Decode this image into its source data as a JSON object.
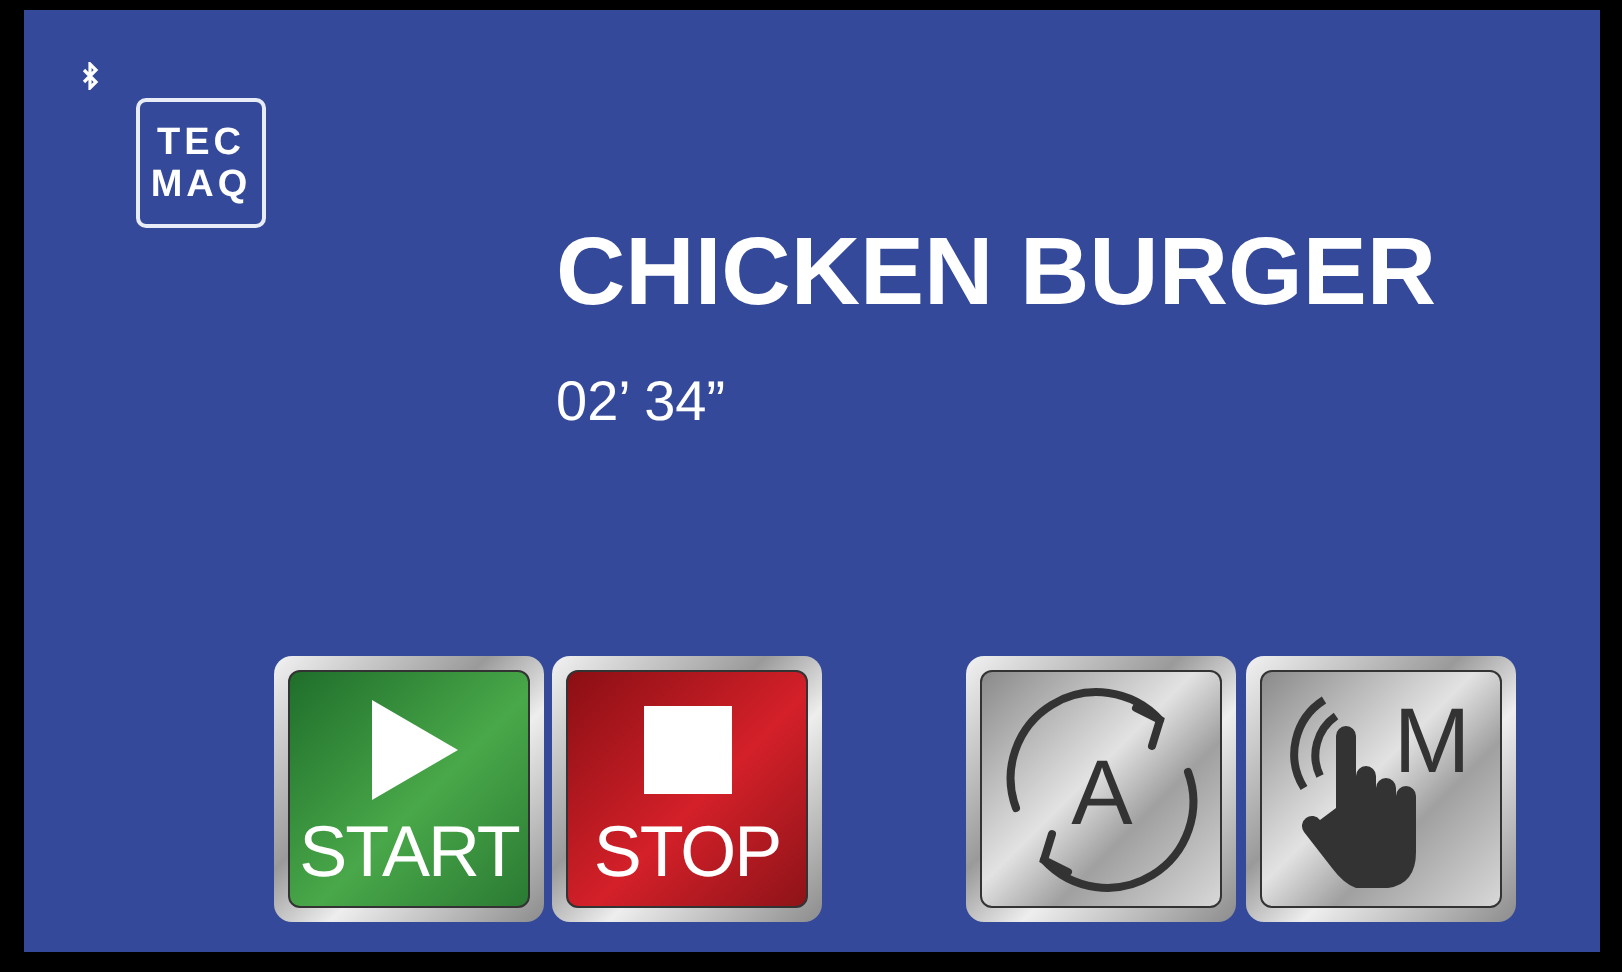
{
  "logo": {
    "lines": [
      "TEC",
      "MAQ"
    ]
  },
  "recipe": {
    "name": "CHICKEN BURGER",
    "time": "02’ 34”"
  },
  "buttons": [
    {
      "kind": "start",
      "label": "START"
    },
    {
      "kind": "stop",
      "label": "STOP"
    },
    {
      "kind": "auto",
      "letter": "A"
    },
    {
      "kind": "manual",
      "letter": "M"
    }
  ]
}
